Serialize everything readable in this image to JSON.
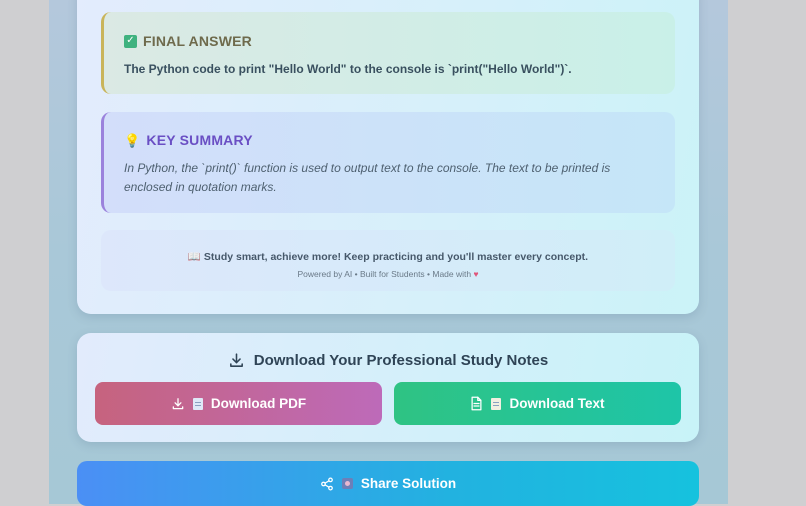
{
  "final_answer": {
    "heading": "FINAL ANSWER",
    "text": "The Python code to print \"Hello World\" to the console is `print(\"Hello World\")`."
  },
  "key_summary": {
    "heading": "KEY SUMMARY",
    "text": "In Python, the `print()` function is used to output text to the console. The text to be printed is enclosed in quotation marks."
  },
  "footer": {
    "tagline": "Study smart, achieve more! Keep practicing and you'll master every concept.",
    "credits": "Powered by AI • Built for Students • Made with"
  },
  "download": {
    "heading": "Download Your Professional Study Notes",
    "pdf_label": "Download PDF",
    "text_label": "Download Text"
  },
  "share": {
    "label": "Share Solution"
  },
  "colors": {
    "final_accent": "#c9b45a",
    "summary_accent": "#9b82dc",
    "pdf_button": "#c6637e",
    "text_button": "#2fc383",
    "share_button": "#4b8ff5"
  },
  "icons": {
    "final": "check-mark-icon",
    "summary": "light-bulb-icon",
    "footer": "open-book-icon",
    "download_heading": "download-icon",
    "pdf": "download-icon",
    "text_file": "file-text-icon",
    "share": "share-icon",
    "heart": "heart-icon"
  }
}
